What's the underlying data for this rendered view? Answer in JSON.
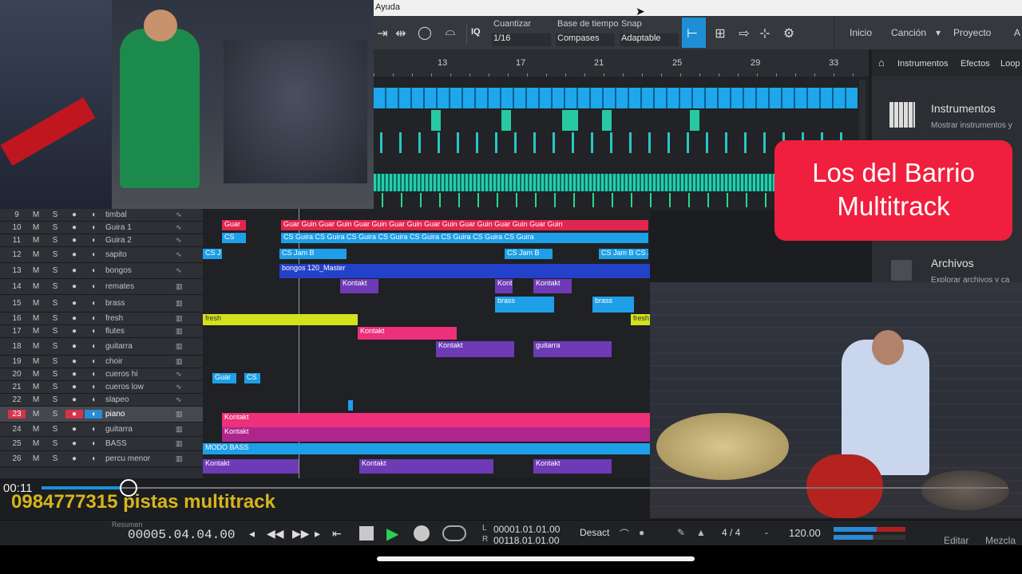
{
  "menubar": {
    "item": "Ayuda"
  },
  "toolbar": {
    "quantize_label": "Cuantizar",
    "quantize_value": "1/16",
    "timebase_label": "Base de tiempo",
    "timebase_value": "Compases",
    "snap_label": "Snap",
    "snap_value": "Adaptable",
    "iq_label": "IQ",
    "nav": [
      "Inicio",
      "Canción",
      "Proyecto",
      "A"
    ]
  },
  "ruler": {
    "marks": [
      "13",
      "17",
      "21",
      "25",
      "29",
      "33"
    ]
  },
  "right_panel": {
    "tabs": [
      "Instrumentos",
      "Efectos",
      "Loop"
    ],
    "sections": [
      {
        "title": "Instrumentos",
        "desc": "Mostrar instrumentos y"
      },
      {
        "title": "Archivos",
        "desc": "Explorar archivos y ca"
      }
    ]
  },
  "tracks": [
    {
      "num": "9",
      "name": "timbal",
      "type": "audio"
    },
    {
      "num": "10",
      "name": "Guira 1",
      "type": "audio"
    },
    {
      "num": "11",
      "name": "Guira 2",
      "type": "audio"
    },
    {
      "num": "12",
      "name": "sapito",
      "type": "audio"
    },
    {
      "num": "13",
      "name": "bongos",
      "type": "audio"
    },
    {
      "num": "14",
      "name": "remates",
      "type": "instrument"
    },
    {
      "num": "15",
      "name": "brass",
      "type": "instrument"
    },
    {
      "num": "16",
      "name": "fresh",
      "type": "instrument"
    },
    {
      "num": "17",
      "name": "flutes",
      "type": "instrument"
    },
    {
      "num": "18",
      "name": "guitarra",
      "type": "instrument"
    },
    {
      "num": "19",
      "name": "choir",
      "type": "instrument"
    },
    {
      "num": "20",
      "name": "cueros hi",
      "type": "audio"
    },
    {
      "num": "21",
      "name": "cueros low",
      "type": "audio"
    },
    {
      "num": "22",
      "name": "slapeo",
      "type": "audio"
    },
    {
      "num": "23",
      "name": "piano",
      "type": "instrument"
    },
    {
      "num": "24",
      "name": "guitarra",
      "type": "instrument"
    },
    {
      "num": "25",
      "name": "BASS",
      "type": "instrument"
    },
    {
      "num": "26",
      "name": "percu menor",
      "type": "instrument"
    }
  ],
  "track_buttons": {
    "mute": "M",
    "solo": "S"
  },
  "clips": {
    "guar": "Guar",
    "guar_guin": "Guar Guin Guar Guin Guar Guin Guar Guin Guar Guin Guar Guin Guar Guin Guar Guin",
    "cs_guira": "CS Guira  CS Guira  CS Guira  CS Guira  CS Guira  CS Guira  CS Guira  CS Guira",
    "cs_jam": "CS Jam B  CS Jam B  CS Jam B  CS Jam B  CS Jam B  CS Jam B",
    "cs_jam_short": "CS Jam B",
    "cs": "CS J",
    "bongos": "bongos 120_Master",
    "kontakt": "Kontakt",
    "brass": "brass",
    "fresh": "fresh",
    "guitarra": "guitarra",
    "guar2": "Guar",
    "cs2": "CS",
    "modo_bass": "MODO BASS",
    "kont_kon": "Kont Kon",
    "m": "M"
  },
  "overlay": {
    "badge_line1": "Los del Barrio",
    "badge_line2": "Multitrack",
    "video_time": "00:11",
    "phone_text": "0984777315 pistas multitrack",
    "scrub_progress": 0.18
  },
  "transport": {
    "position": "00005.04.04.00",
    "loop_start": "00001.01.01.00",
    "loop_end": "00118.01.01.00",
    "loop_L": "L",
    "loop_R": "R",
    "desact": "Desact",
    "signature": "4 / 4",
    "dash": "-",
    "tempo": "120.00",
    "editar": "Editar",
    "mezcla": "Mezcla",
    "resumen": "Resumen"
  },
  "colors": {
    "accent_red": "#f01f3e",
    "clip_blue": "#1e9fe8",
    "clip_purple": "#6e3ab6",
    "clip_pink": "#ee2f7a",
    "clip_yellow": "#d4e21b",
    "clip_green": "#2fd6a8",
    "scrub_text": "#d6b51c"
  }
}
